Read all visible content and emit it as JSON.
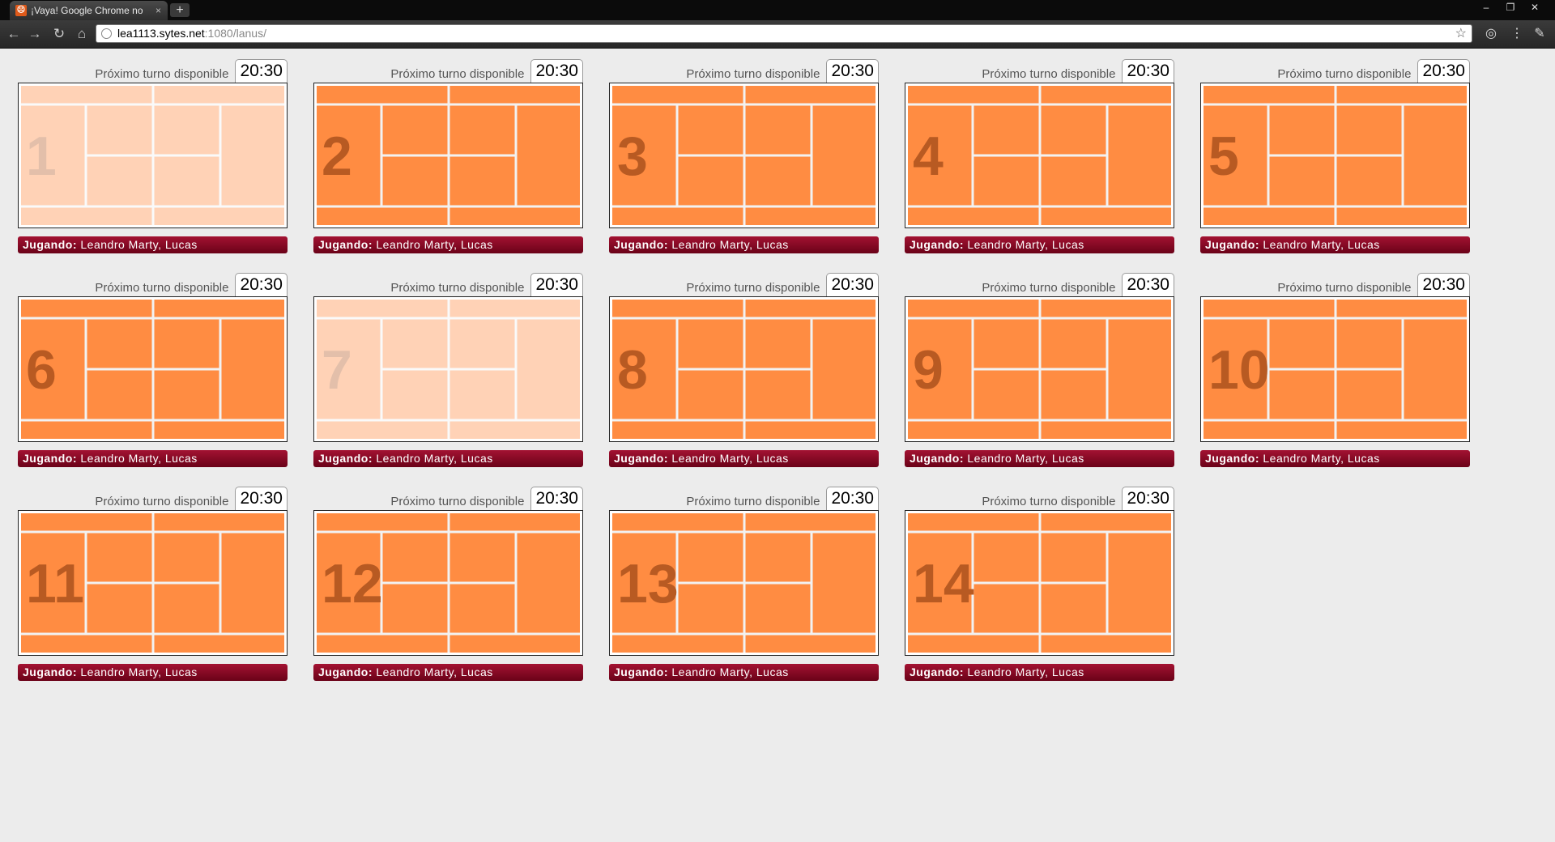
{
  "browser": {
    "tab_title": "¡Vaya! Google Chrome no h",
    "tab_close": "×",
    "new_tab": "+",
    "url_host": "lea1113.sytes.net",
    "url_rest": ":1080/lanus/",
    "window_controls": [
      "–",
      "❐",
      "✕"
    ]
  },
  "colors": {
    "court_orange": "#ff8c42",
    "court_line": "#f2f2f2",
    "number_color": "#b85a22",
    "player_bar": "#8a0a26"
  },
  "court_labels": {
    "next_label": "Próximo turno disponible",
    "playing_label": "Jugando:"
  },
  "courts": [
    {
      "number": "1",
      "next_time": "20:30",
      "players": "Leandro Marty, Lucas",
      "faded": true
    },
    {
      "number": "2",
      "next_time": "20:30",
      "players": "Leandro Marty, Lucas",
      "faded": false
    },
    {
      "number": "3",
      "next_time": "20:30",
      "players": "Leandro Marty, Lucas",
      "faded": false
    },
    {
      "number": "4",
      "next_time": "20:30",
      "players": "Leandro Marty, Lucas",
      "faded": false
    },
    {
      "number": "5",
      "next_time": "20:30",
      "players": "Leandro Marty, Lucas",
      "faded": false
    },
    {
      "number": "6",
      "next_time": "20:30",
      "players": "Leandro Marty, Lucas",
      "faded": false
    },
    {
      "number": "7",
      "next_time": "20:30",
      "players": "Leandro Marty, Lucas",
      "faded": true
    },
    {
      "number": "8",
      "next_time": "20:30",
      "players": "Leandro Marty, Lucas",
      "faded": false
    },
    {
      "number": "9",
      "next_time": "20:30",
      "players": "Leandro Marty, Lucas",
      "faded": false
    },
    {
      "number": "10",
      "next_time": "20:30",
      "players": "Leandro Marty, Lucas",
      "faded": false
    },
    {
      "number": "11",
      "next_time": "20:30",
      "players": "Leandro Marty, Lucas",
      "faded": false
    },
    {
      "number": "12",
      "next_time": "20:30",
      "players": "Leandro Marty, Lucas",
      "faded": false
    },
    {
      "number": "13",
      "next_time": "20:30",
      "players": "Leandro Marty, Lucas",
      "faded": false
    },
    {
      "number": "14",
      "next_time": "20:30",
      "players": "Leandro Marty, Lucas",
      "faded": false
    }
  ]
}
